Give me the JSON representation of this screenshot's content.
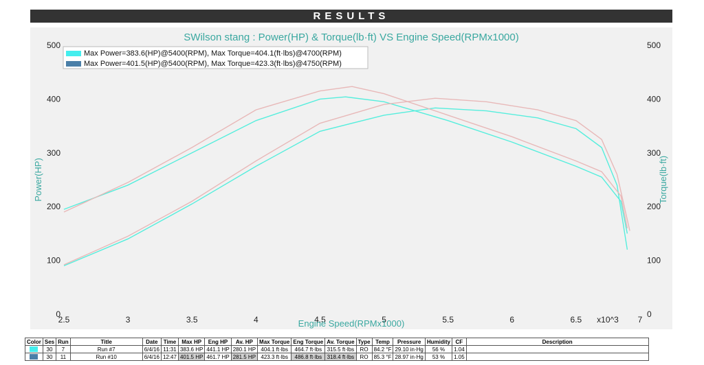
{
  "header": {
    "title": "RESULTS"
  },
  "chart_data": {
    "type": "line",
    "title": "SWilson stang : Power(HP) & Torque(lb·ft) VS Engine Speed(RPMx1000)",
    "xlabel": "Engine Speed(RPMx1000)",
    "ylabel_left": "Power(HP)",
    "ylabel_right": "Torque(lb·ft)",
    "x_multiplier_label": "x10^3",
    "xlim": [
      2.5,
      7
    ],
    "ylim": [
      0,
      500
    ],
    "x_ticks": [
      "2.5",
      "3",
      "3.5",
      "4",
      "4.5",
      "5",
      "5.5",
      "6",
      "6.5",
      "7"
    ],
    "y_ticks": [
      "0",
      "100",
      "200",
      "300",
      "400",
      "500"
    ],
    "y_ticks_right": [
      "0",
      "100",
      "200",
      "300",
      "400",
      "500"
    ],
    "legend_position": "top-left",
    "grid": false,
    "series": [
      {
        "name": "Max Power=383.6(HP)@5400(RPM), Max Torque=404.1(ft·lbs)@4700(RPM)",
        "color": "#55eedd",
        "legend_color": "#44eeee",
        "power": {
          "x": [
            2.5,
            3.0,
            3.5,
            4.0,
            4.5,
            5.0,
            5.4,
            5.8,
            6.2,
            6.5,
            6.7,
            6.82,
            6.9
          ],
          "y": [
            90,
            140,
            205,
            275,
            340,
            370,
            383.6,
            378,
            365,
            345,
            310,
            240,
            120
          ]
        },
        "torque": {
          "x": [
            2.5,
            3.0,
            3.5,
            4.0,
            4.5,
            4.7,
            5.0,
            5.5,
            6.0,
            6.5,
            6.7,
            6.85,
            6.9
          ],
          "y": [
            195,
            240,
            300,
            360,
            400,
            404.1,
            395,
            360,
            320,
            275,
            255,
            210,
            150
          ]
        }
      },
      {
        "name": "Max Power=401.5(HP)@5400(RPM), Max Torque=423.3(ft·lbs)@4750(RPM)",
        "color": "#e8b8b8",
        "legend_color": "#4a7fa8",
        "power": {
          "x": [
            2.5,
            3.0,
            3.5,
            4.0,
            4.5,
            5.0,
            5.4,
            5.8,
            6.2,
            6.5,
            6.7,
            6.82,
            6.92
          ],
          "y": [
            92,
            145,
            210,
            285,
            355,
            390,
            401.5,
            395,
            380,
            360,
            325,
            260,
            155
          ]
        },
        "torque": {
          "x": [
            2.5,
            3.0,
            3.5,
            4.0,
            4.5,
            4.75,
            5.0,
            5.5,
            6.0,
            6.5,
            6.7,
            6.85,
            6.9
          ],
          "y": [
            190,
            245,
            310,
            380,
            415,
            423.3,
            410,
            370,
            330,
            285,
            265,
            220,
            160
          ]
        }
      }
    ]
  },
  "table": {
    "headers": [
      "Color",
      "Ses",
      "Run",
      "Title",
      "Date",
      "Time",
      "Max HP",
      "Eng HP",
      "Av. HP",
      "Max Torque",
      "Eng Torque",
      "Av. Torque",
      "Type",
      "Temp",
      "Pressure",
      "Humidity",
      "CF",
      "Description"
    ],
    "rows": [
      {
        "color": "#44eeee",
        "cells": [
          "30",
          "7",
          "Run #7",
          "6/4/16",
          "11:31",
          "383.6 HP",
          "441.1 HP",
          "280.1 HP",
          "404.1 ft·lbs",
          "464.7 ft·lbs",
          "315.5 ft·lbs",
          "RO",
          "84.2 °F",
          "29.10 in·Hg",
          "56 %",
          "1.04",
          ""
        ]
      },
      {
        "color": "#4a7fa8",
        "cells": [
          "30",
          "11",
          "Run #10",
          "6/4/16",
          "12:47",
          "401.5 HP",
          "461.7 HP",
          "281.5 HP",
          "423.3 ft·lbs",
          "486.8 ft·lbs",
          "318.4 ft·lbs",
          "RO",
          "85.3 °F",
          "28.97 in·Hg",
          "53 %",
          "1.05",
          ""
        ]
      }
    ]
  }
}
